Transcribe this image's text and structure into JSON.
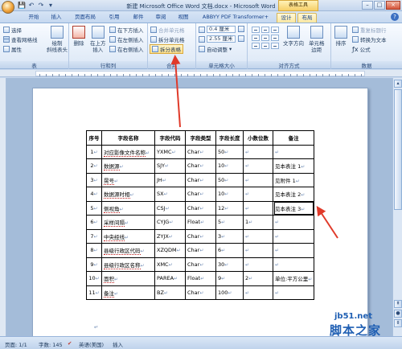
{
  "window": {
    "title": "新建 Microsoft Office Word 文档.docx - Microsoft Word",
    "contextual_tool": "表格工具",
    "minimize": "–",
    "maximize": "□",
    "close": "×"
  },
  "qat": [
    "💾",
    "↶",
    "↷",
    "▾"
  ],
  "tabs": [
    {
      "label": "开始"
    },
    {
      "label": "插入"
    },
    {
      "label": "页面布局"
    },
    {
      "label": "引用"
    },
    {
      "label": "邮件"
    },
    {
      "label": "审阅"
    },
    {
      "label": "视图"
    },
    {
      "label": "ABBYY PDF Transformer+"
    },
    {
      "label": "设计"
    },
    {
      "label": "布局"
    }
  ],
  "help": "?",
  "ribbon": {
    "table_group": {
      "label": "表",
      "select": "选择",
      "gridlines": "查看网格线",
      "properties": "属性",
      "draw_line1": "绘制",
      "draw_line2": "斜线表头"
    },
    "rows_cols_group": {
      "label": "行和列",
      "delete": "删除",
      "insert_above_line1": "在上方",
      "insert_above_line2": "插入",
      "insert_below": "在下方插入",
      "insert_left": "在左侧插入",
      "insert_right": "在右侧插入"
    },
    "merge_group": {
      "label": "合并",
      "merge_cells": "合并单元格",
      "split_cells": "拆分单元格",
      "split_table": "拆分表格"
    },
    "cell_size_group": {
      "label": "单元格大小",
      "height": "0.4 厘米",
      "width": "2.55 厘米",
      "autofit": "自动调整"
    },
    "alignment_group": {
      "label": "对齐方式",
      "text_direction_line1": "文字方向",
      "cell_margins_line1": "单元格",
      "cell_margins_line2": "边距"
    },
    "data_group": {
      "label": "数据",
      "sort": "排序",
      "repeat_header": "重复标题行",
      "convert_to_text": "转换为文本",
      "formula": "公式"
    }
  },
  "table": {
    "headers": [
      "序号",
      "字段名称",
      "字段代码",
      "字段类型",
      "字段长度",
      "小数位数",
      "备注"
    ],
    "rows": [
      [
        "1",
        "对应影像文件名称",
        "YXMC",
        "Char",
        "50",
        "",
        ""
      ],
      [
        "2",
        "数据源",
        "SJY",
        "Char",
        "10",
        "",
        "见本表注 1"
      ],
      [
        "3",
        "晃号",
        "JH",
        "Char",
        "50",
        "",
        "见附件 1"
      ],
      [
        "4",
        "数据源时相",
        "SX",
        "Char",
        "10",
        "",
        "见本表注 2"
      ],
      [
        "5",
        "侧视角",
        "CSJ",
        "Char",
        "12",
        "",
        "见本表注 3"
      ],
      [
        "6",
        "采样间隔",
        "CYJG",
        "Float",
        "5",
        "1",
        ""
      ],
      [
        "7",
        "中央经线",
        "ZYJX",
        "Char",
        "3",
        "",
        ""
      ],
      [
        "8",
        "县级行政区代码",
        "XZQDM",
        "Char",
        "6",
        "",
        ""
      ],
      [
        "9",
        "县级行政区名称",
        "XMC",
        "Char",
        "30",
        "",
        ""
      ],
      [
        "10",
        "面积",
        "PAREA",
        "Float",
        "9",
        "2",
        "单位:平方公里"
      ],
      [
        "11",
        "备注",
        "BZ",
        "Char",
        "100",
        "",
        ""
      ]
    ]
  },
  "status": {
    "page": "页面: 1/1",
    "words": "字数: 145",
    "language": "英语(美国)",
    "insert_mode": "插入"
  },
  "watermark": {
    "url": "jb51.net",
    "brand": "脚本之家"
  }
}
